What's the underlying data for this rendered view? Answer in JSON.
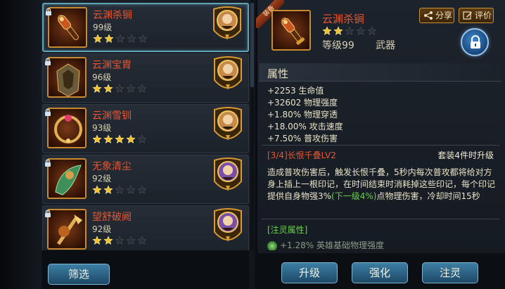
{
  "equipment_list": {
    "items": [
      {
        "name": "云渊杀锏",
        "level": "99级",
        "stars": 2,
        "hero_tone": "#c58a4a",
        "locked": true,
        "selected": true
      },
      {
        "name": "云渊宝胄",
        "level": "96级",
        "stars": 2,
        "hero_tone": "#c58a4a",
        "locked": true,
        "selected": false
      },
      {
        "name": "云渊雪钏",
        "level": "93级",
        "stars": 4,
        "hero_tone": "#c58a4a",
        "locked": true,
        "selected": false
      },
      {
        "name": "无象清尘",
        "level": "92级",
        "stars": 2,
        "hero_tone": "#7b4fa8",
        "locked": true,
        "selected": false
      },
      {
        "name": "望舒破阙",
        "level": "92级",
        "stars": 2,
        "hero_tone": "#7b4fa8",
        "locked": true,
        "selected": false
      }
    ],
    "max_stars": 5,
    "filter_label": "筛选"
  },
  "detail": {
    "ribbon": "装备",
    "name": "云渊杀锏",
    "stars": 2,
    "level": "等级99",
    "type": "武器",
    "share_label": "分享",
    "rate_label": "评价",
    "attributes_title": "属性",
    "attributes": [
      "+2253 生命值",
      "+32602 物理强度",
      "+1.80% 物理穿透",
      "+18.00% 攻击速度",
      "+7.50% 普攻伤害"
    ],
    "set_title": "[3/4]长恨千叠LV2",
    "set_note": "套装4件时升级",
    "set_desc_before": "造成普攻伤害后，触发长恨千叠，5秒内每次普攻都将给对方身上插上一根印记，在时间结束时消耗掉这些印记，每个印记提供自身物强3%",
    "set_desc_highlight": "(下一级4%)",
    "set_desc_after": "点物理伤害，冷却时间15秒",
    "spirit_title": "[注灵属性]",
    "spirit_line": "+1.28% 英雄基础物理强度"
  },
  "actions": {
    "upgrade": "升级",
    "enhance": "强化",
    "spirit": "注灵"
  },
  "colors": {
    "item_name": "#e85530",
    "star_on": "#f2c12e",
    "star_off": "#2a2f36",
    "button_blue": "#2f6c94",
    "highlight_green": "#6ad04a"
  }
}
